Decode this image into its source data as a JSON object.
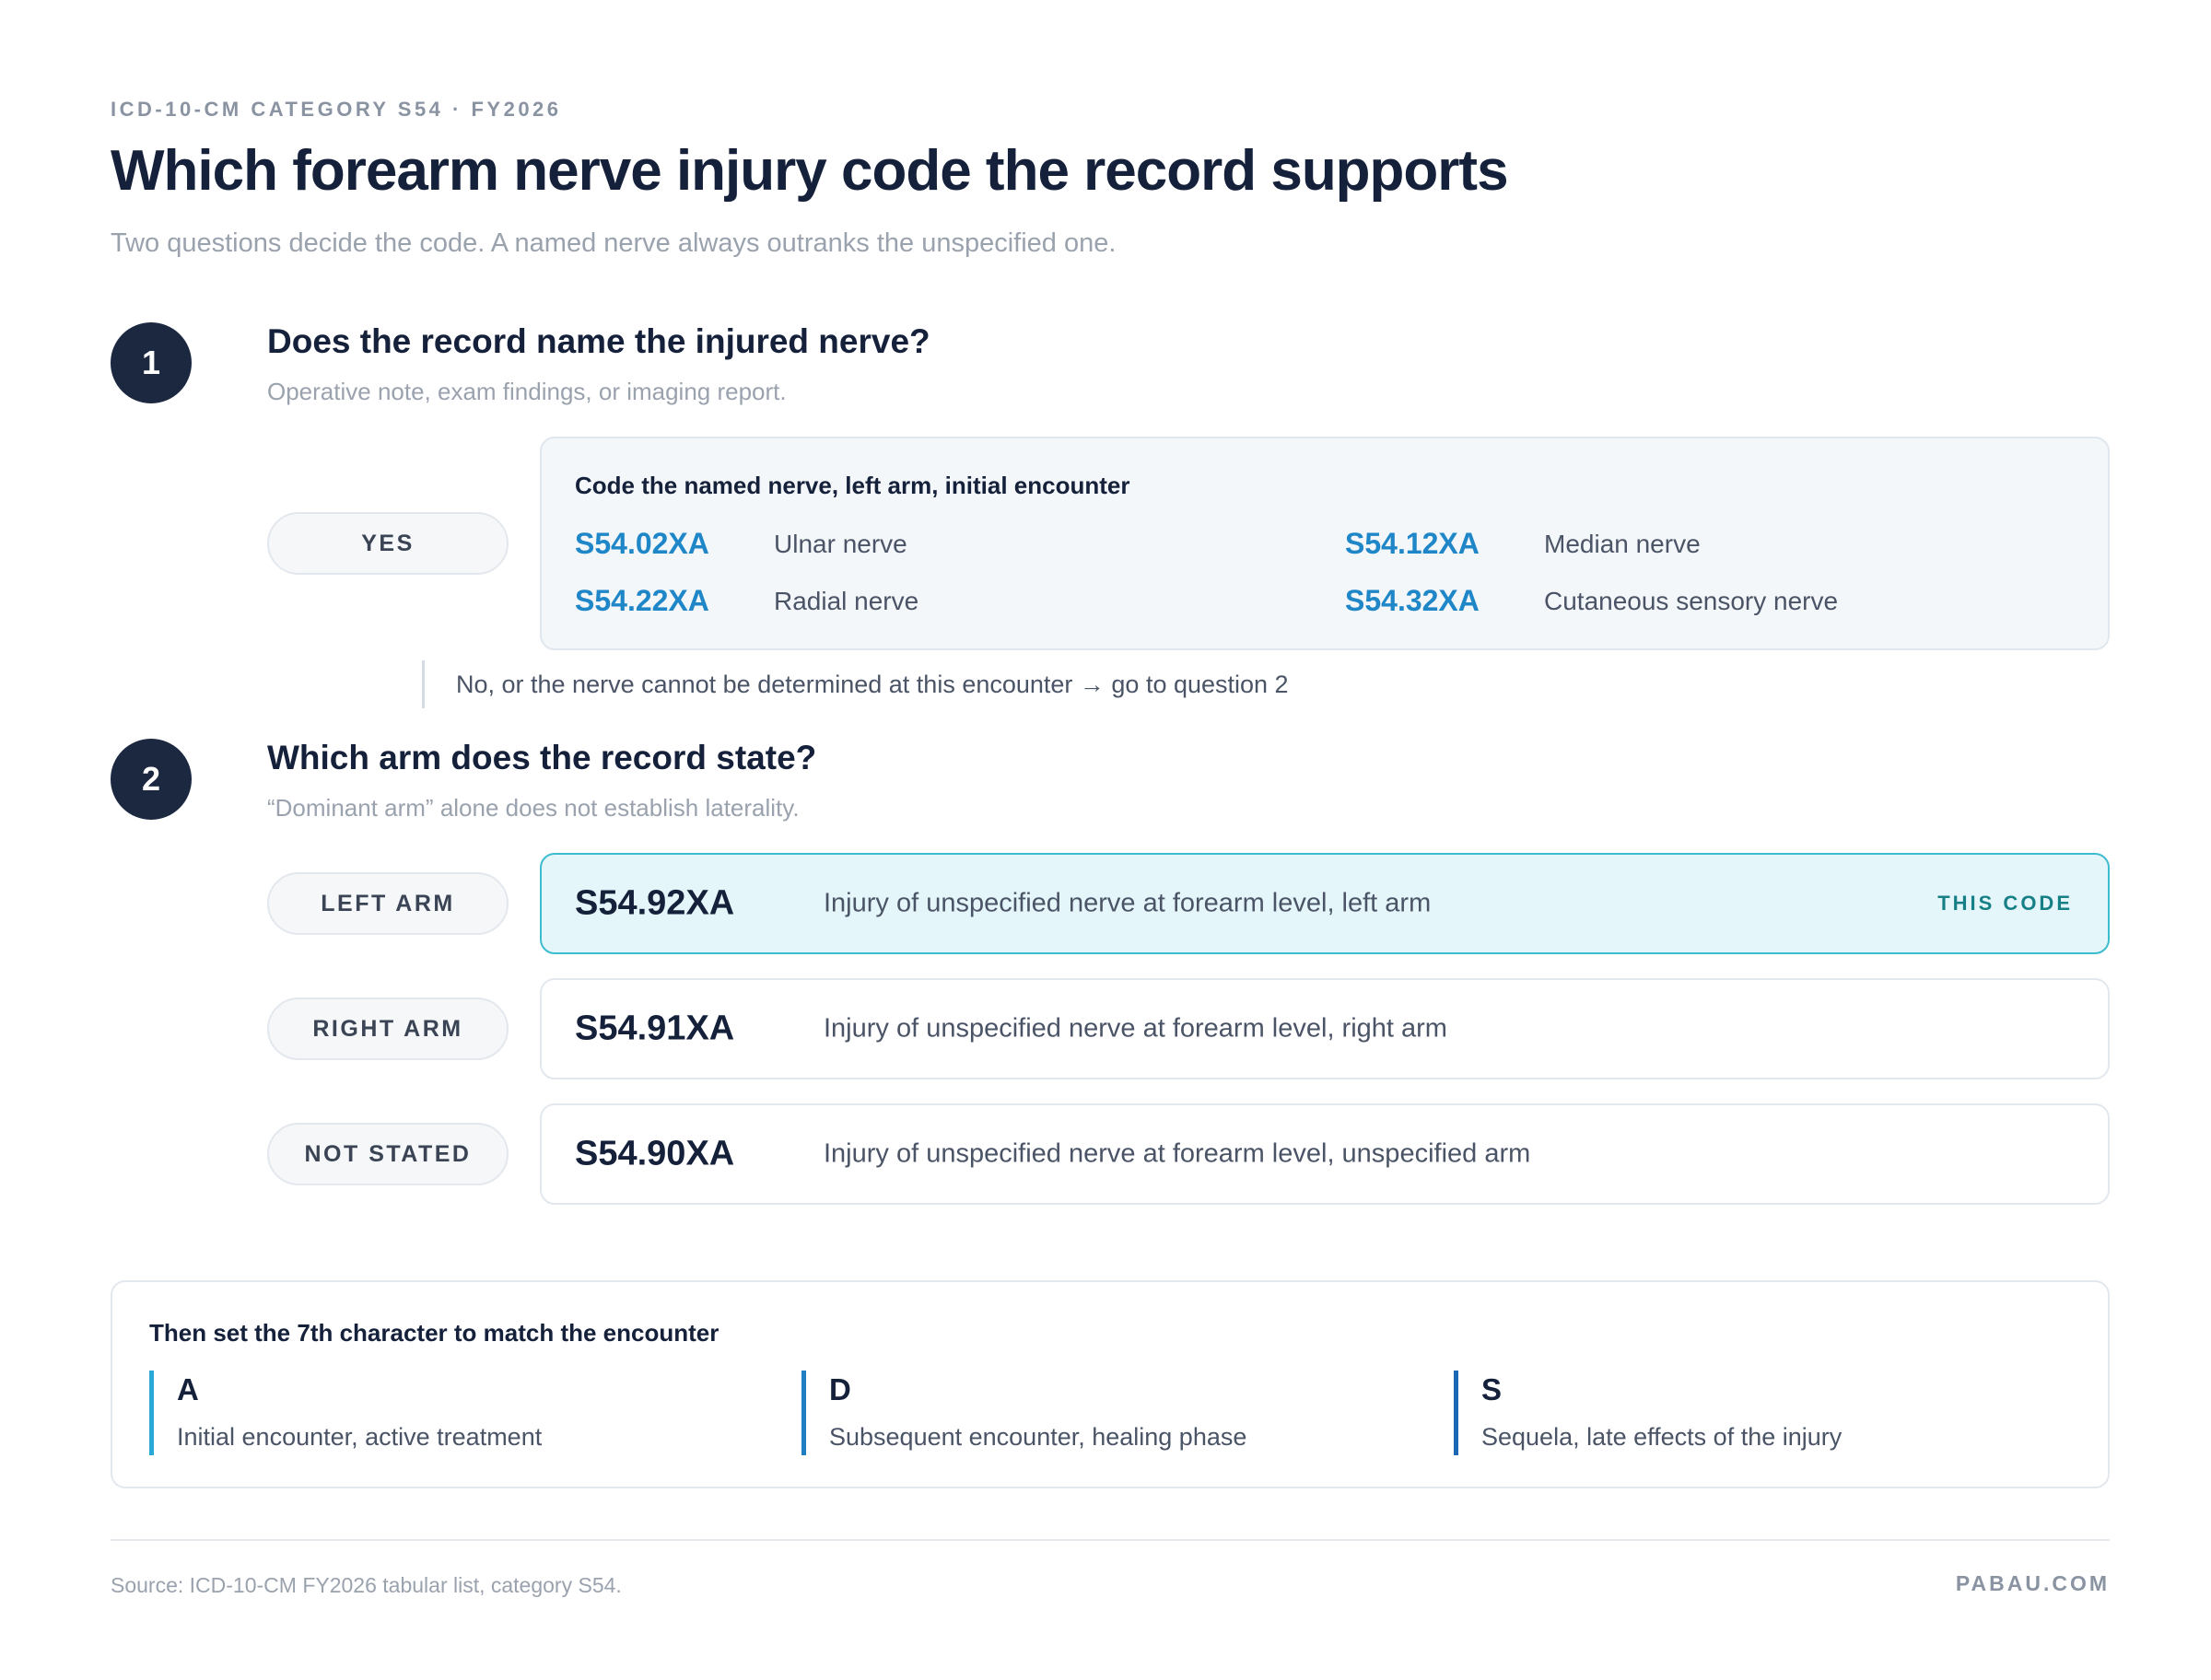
{
  "header": {
    "eyebrow": "ICD-10-CM CATEGORY S54 · FY2026",
    "title": "Which forearm nerve injury code the record supports",
    "subtitle": "Two questions decide the code. A named nerve always outranks the unspecified one."
  },
  "question1": {
    "number": "1",
    "title": "Does the record name the injured nerve?",
    "subtitle": "Operative note, exam findings, or imaging report.",
    "yes_label": "YES",
    "yes_box_title": "Code the named nerve, left arm, initial encounter",
    "codes": [
      {
        "code": "S54.02XA",
        "label": "Ulnar nerve"
      },
      {
        "code": "S54.12XA",
        "label": "Median nerve"
      },
      {
        "code": "S54.22XA",
        "label": "Radial nerve"
      },
      {
        "code": "S54.32XA",
        "label": "Cutaneous sensory nerve"
      }
    ],
    "no_branch": "No, or the nerve cannot be determined at this encounter → go to question 2"
  },
  "question2": {
    "number": "2",
    "title": "Which arm does the record state?",
    "subtitle": "“Dominant arm” alone does not establish laterality.",
    "options": [
      {
        "label": "LEFT ARM",
        "code": "S54.92XA",
        "description": "Injury of unspecified nerve at forearm level, left arm",
        "selected": true,
        "badge": "THIS CODE"
      },
      {
        "label": "RIGHT ARM",
        "code": "S54.91XA",
        "description": "Injury of unspecified nerve at forearm level, right arm",
        "selected": false
      },
      {
        "label": "NOT STATED",
        "code": "S54.90XA",
        "description": "Injury of unspecified nerve at forearm level, unspecified arm",
        "selected": false
      }
    ]
  },
  "seventh_character": {
    "title": "Then set the 7th character to match the encounter",
    "items": [
      {
        "letter": "A",
        "description": "Initial encounter, active treatment",
        "color": "#2aa9d8"
      },
      {
        "letter": "D",
        "description": "Subsequent encounter, healing phase",
        "color": "#1f7fc2"
      },
      {
        "letter": "S",
        "description": "Sequela, late effects of the injury",
        "color": "#1a68b3"
      }
    ]
  },
  "footer": {
    "source": "Source: ICD-10-CM FY2026 tabular list, category S54.",
    "brand": "PABAU.COM"
  },
  "colors": {
    "accent": "#1f86c8",
    "selected_border": "#3cbccf",
    "selected_fill": "#e5f6fa",
    "badge": "#177f86",
    "step_circle": "#1b2840"
  }
}
